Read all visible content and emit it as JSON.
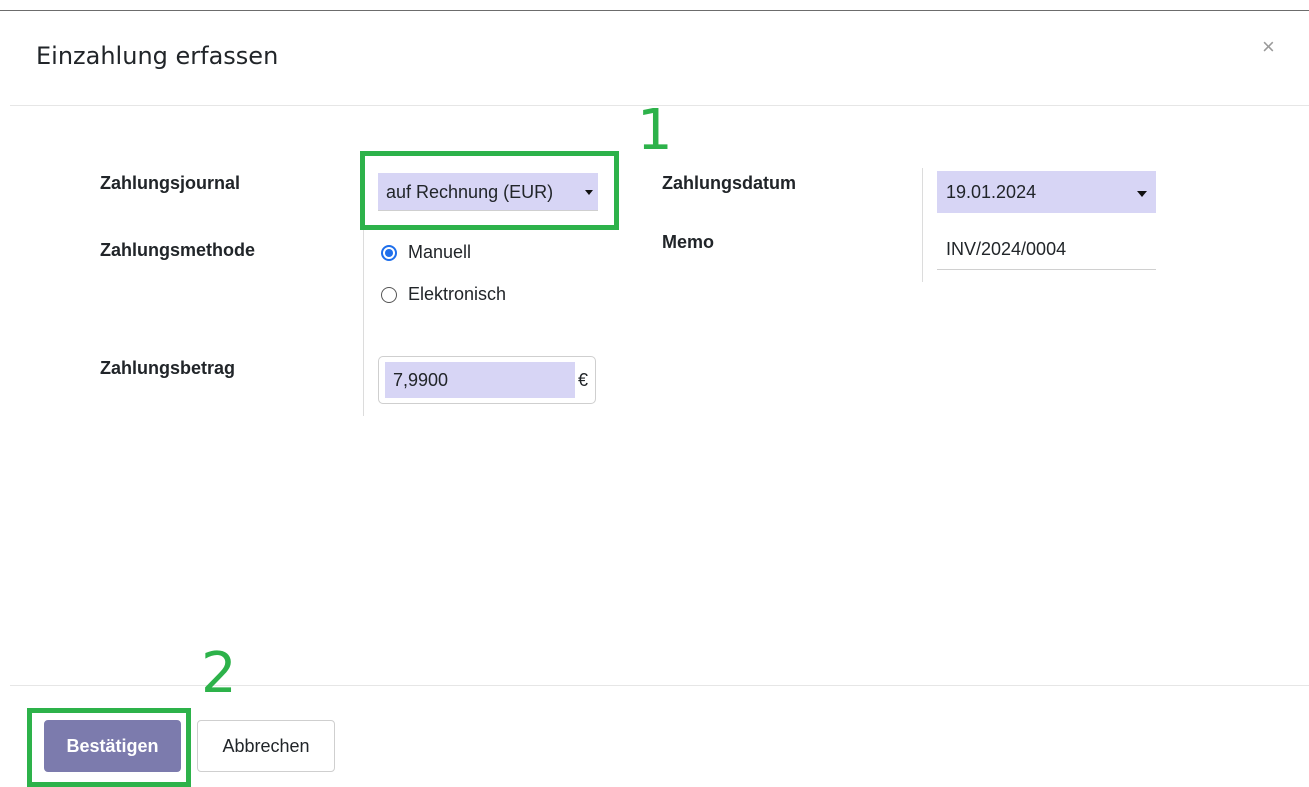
{
  "dialog": {
    "title": "Einzahlung erfassen",
    "close_label": "×"
  },
  "form": {
    "journal_label": "Zahlungsjournal",
    "journal_value": "auf Rechnung (EUR)",
    "method_label": "Zahlungsmethode",
    "method_options": [
      {
        "label": "Manuell",
        "selected": true
      },
      {
        "label": "Elektronisch",
        "selected": false
      }
    ],
    "amount_label": "Zahlungsbetrag",
    "amount_value": "7,9900",
    "currency_symbol": "€",
    "date_label": "Zahlungsdatum",
    "date_value": "19.01.2024",
    "memo_label": "Memo",
    "memo_value": "INV/2024/0004"
  },
  "footer": {
    "confirm_label": "Bestätigen",
    "cancel_label": "Abbrechen"
  },
  "annotations": {
    "marker_1": "1",
    "marker_2": "2",
    "highlight_color": "#2db24a"
  },
  "colors": {
    "field_highlight": "#d7d5f5",
    "primary_button": "#7c7bad",
    "radio_accent": "#1f6feb"
  },
  "icons": {
    "close": "close-icon",
    "dropdown": "caret-down-icon"
  }
}
